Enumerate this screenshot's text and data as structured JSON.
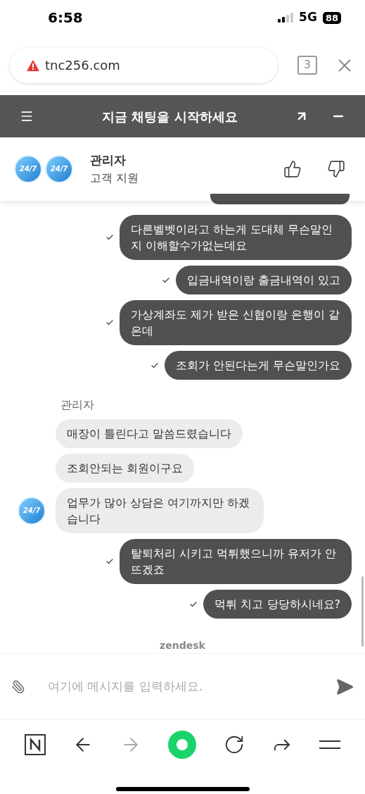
{
  "status_bar": {
    "time": "6:58",
    "network": "5G",
    "battery": "88"
  },
  "address_bar": {
    "url": "tnc256.com",
    "insecure": true,
    "tab_count": "3"
  },
  "chat_header": {
    "title": "지금 채팅을 시작하세요"
  },
  "agent": {
    "avatars": [
      "24/7",
      "24/7"
    ],
    "name": "관리자",
    "role": "고객 지원"
  },
  "messages": [
    {
      "kind": "sent",
      "text": "다른벨벳이라고 하는게 도대체 무슨말인지 이해할수가없는데요",
      "delivered": true
    },
    {
      "kind": "sent",
      "text": "입금내역이랑 출금내역이 있고",
      "delivered": true
    },
    {
      "kind": "sent",
      "text": "가상계좌도 제가 받은 신협이랑 은행이 같은데",
      "delivered": true
    },
    {
      "kind": "sent",
      "text": "조회가 안된다는게 무슨말인가요",
      "delivered": true
    },
    {
      "kind": "sender",
      "text": "관리자"
    },
    {
      "kind": "received",
      "text": "매장이 틀린다고 말씀드렸습니다"
    },
    {
      "kind": "received",
      "text": "조회안되는 회원이구요"
    },
    {
      "kind": "received",
      "text": "업무가 많아 상담은 여기까지만 하겠습니다",
      "avatar": "24/7"
    },
    {
      "kind": "sent",
      "text": "탈퇴처리 시키고 먹튀했으니까 유저가 안뜨겠죠",
      "delivered": true
    },
    {
      "kind": "sent",
      "text": "먹튀 치고 당당하시네요?",
      "delivered": true
    }
  ],
  "branding": "zendesk",
  "composer": {
    "placeholder": "여기에 메시지를 입력하세요."
  }
}
